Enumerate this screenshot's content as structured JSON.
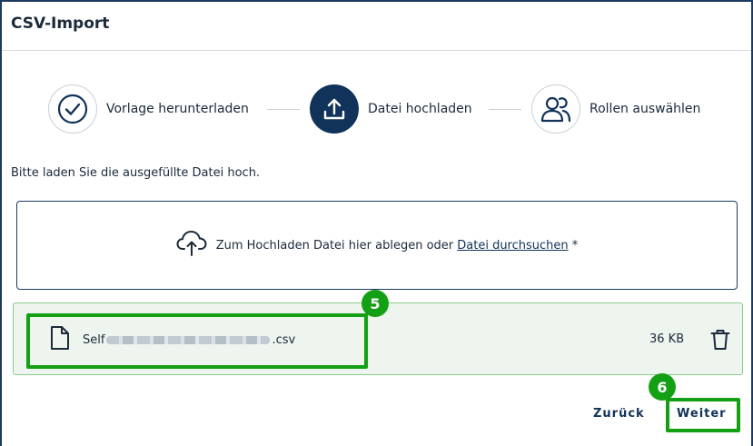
{
  "dialog": {
    "title": "CSV-Import"
  },
  "stepper": {
    "steps": [
      {
        "label": "Vorlage herunterladen",
        "icon": "check-circle-icon",
        "state": "completed"
      },
      {
        "label": "Datei hochladen",
        "icon": "upload-icon",
        "state": "active"
      },
      {
        "label": "Rollen auswählen",
        "icon": "users-icon",
        "state": "pending"
      }
    ]
  },
  "upload": {
    "instruction": "Bitte laden Sie die ausgefüllte Datei hoch.",
    "dropzone_text": "Zum Hochladen Datei hier ablegen oder ",
    "dropzone_link": "Datei durchsuchen",
    "required_marker": " *",
    "icon": "cloud-upload-icon"
  },
  "file": {
    "name_prefix": "Self",
    "name_suffix": ".csv",
    "size": "36 KB",
    "icon": "file-icon",
    "delete_icon": "trash-icon"
  },
  "annotations": {
    "badge_file": "5",
    "badge_next": "6",
    "color": "#14a014"
  },
  "actions": {
    "back_label": "Zurück",
    "next_label": "Weiter"
  },
  "colors": {
    "primary": "#11335a",
    "success_border": "#8cc98c",
    "success_bg": "#eef4ee"
  }
}
